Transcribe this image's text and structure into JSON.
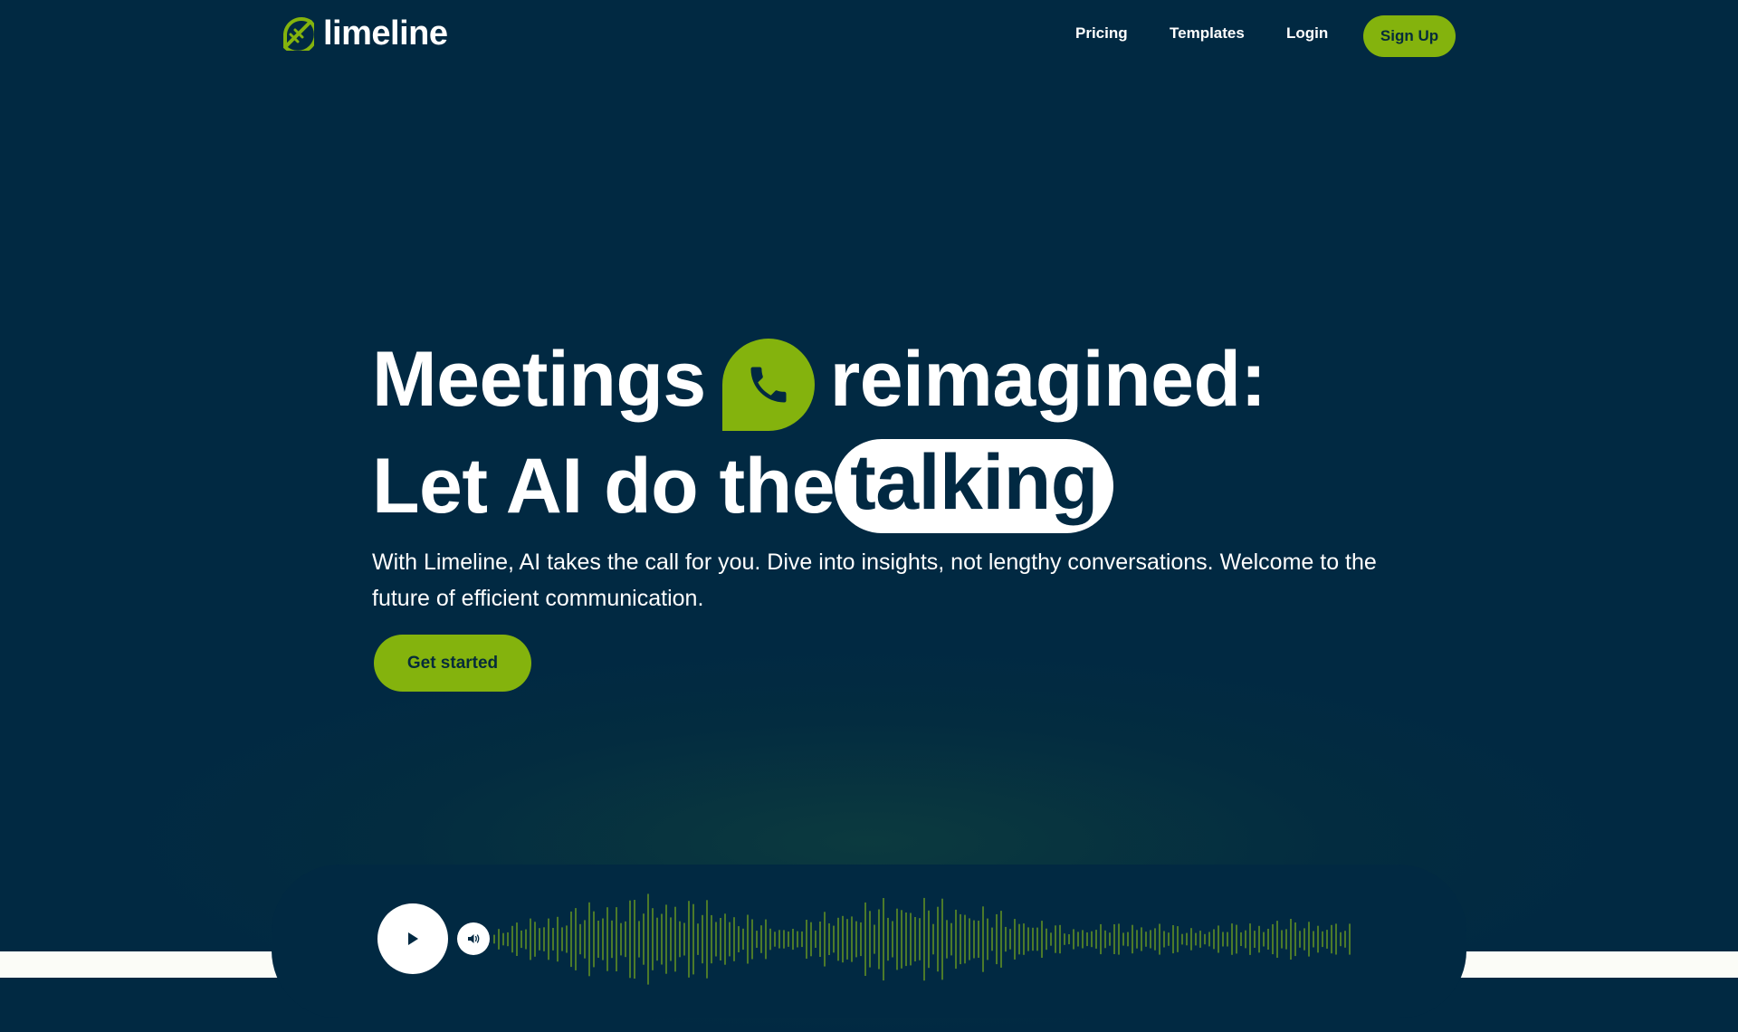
{
  "brand": {
    "name": "limeline"
  },
  "nav": {
    "links": [
      {
        "label": "Pricing"
      },
      {
        "label": "Templates"
      },
      {
        "label": "Login"
      }
    ],
    "signup_label": "Sign Up"
  },
  "hero": {
    "headline_part1": "Meetings",
    "headline_part2": "reimagined:",
    "headline_line2": "Let AI do the",
    "highlight_word": "talking",
    "subheading": "With Limeline, AI takes the call for you. Dive into insights, not lengthy conversations. Welcome to the future of efficient communication.",
    "cta_label": "Get started"
  },
  "player": {
    "play_icon": "play-icon",
    "volume_icon": "volume-icon"
  },
  "colors": {
    "background": "#012942",
    "accent": "#84b30d",
    "waveform": "#4c7a2a",
    "text": "#ffffff"
  }
}
